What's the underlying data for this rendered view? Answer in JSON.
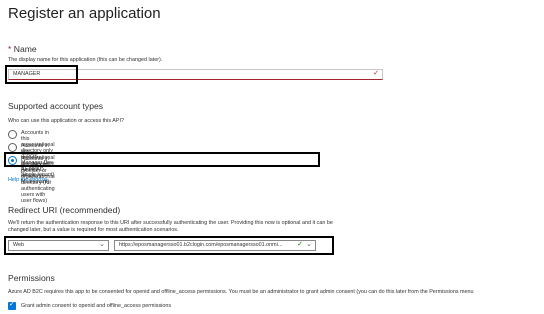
{
  "header": {
    "title": "Register an application",
    "more_label": "···"
  },
  "name_section": {
    "required_mark": "*",
    "label": "Name",
    "description": "The display name for this application (this can be changed later).",
    "input_value": "MANAGER",
    "valid_icon": "✓"
  },
  "account_types": {
    "heading": "Supported account types",
    "question": "Who can use this application or access this API?",
    "options": [
      {
        "label": "Accounts in this organizational directory only (EPOS Manager Dev 01 only - Single tenant)",
        "selected": false
      },
      {
        "label": "Accounts in any organizational directory (Any Azure AD directory – Multitenant)",
        "selected": false
      },
      {
        "label": "Accounts in any identity provider or organizational directory (for authenticating users with user flows)",
        "selected": true
      }
    ],
    "help_link": "Help me choose..."
  },
  "redirect": {
    "heading": "Redirect URI (recommended)",
    "description_line1": "We'll return the authentication response to this URI after successfully authenticating the user. Providing this now is optional and it can be",
    "description_line2": "changed later, but a value is required for most authentication scenarios.",
    "platform_value": "Web",
    "uri_value": "https://eposmanagersso01.b2clogin.com/eposmanagersso01.onmi...",
    "chevron_icon": "chevron-down-icon",
    "valid_icon": "✓"
  },
  "permissions": {
    "heading": "Permissions",
    "description": "Azure AD B2C requires this app to be consented for openid and offline_access permissions. You must be an administrator to grant admin consent (you can do this later from the Permissions menu",
    "checkbox_label": "Grant admin consent to openid and offline_access permissions",
    "checkbox_checked": true
  },
  "colors": {
    "accent": "#0078d4",
    "error": "#a4262c",
    "text": "#323130",
    "highlight": "#000000"
  }
}
